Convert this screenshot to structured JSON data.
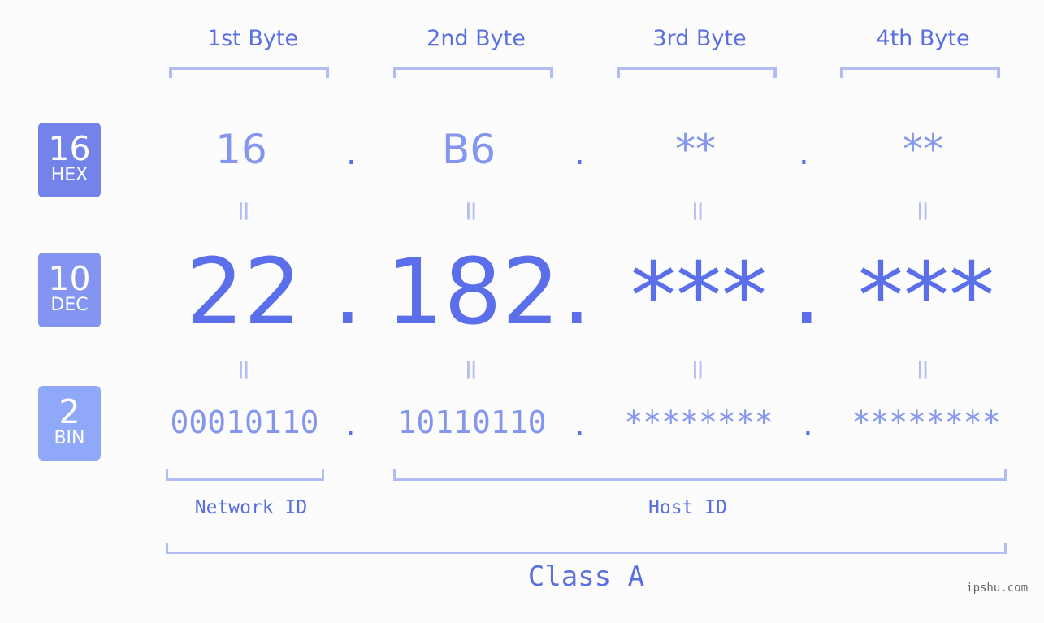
{
  "header": {
    "bytes": [
      "1st Byte",
      "2nd Byte",
      "3rd Byte",
      "4th Byte"
    ]
  },
  "badges": [
    {
      "num": "16",
      "unit": "HEX",
      "color": "#7383ea"
    },
    {
      "num": "10",
      "unit": "DEC",
      "color": "#8494f1"
    },
    {
      "num": "2",
      "unit": "BIN",
      "color": "#8fa8f8"
    }
  ],
  "hex": [
    "16",
    "B6",
    "**",
    "**"
  ],
  "dec": [
    "22",
    "182",
    "***",
    "***"
  ],
  "bin": [
    "00010110",
    "10110110",
    "********",
    "********"
  ],
  "separator": ".",
  "equals": "=",
  "labels": {
    "network": "Network ID",
    "host": "Host ID",
    "class": "Class A"
  },
  "watermark": "ipshu.com"
}
